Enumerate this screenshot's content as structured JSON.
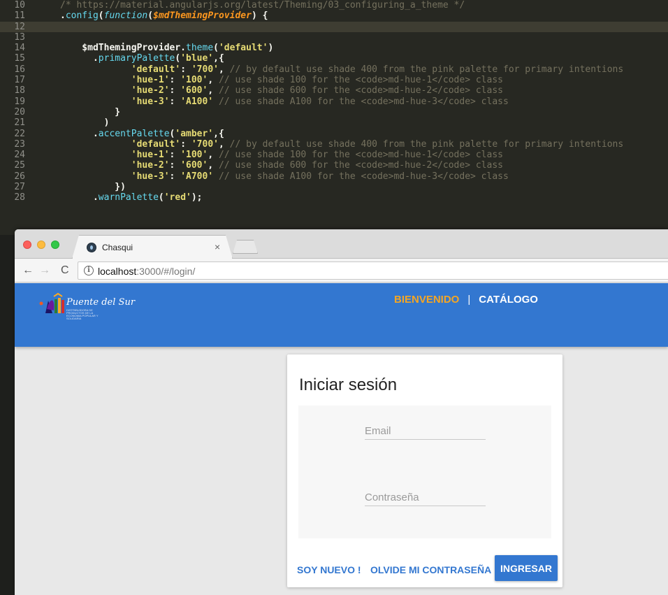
{
  "editor": {
    "active_line": 12,
    "lines": [
      {
        "n": "10",
        "tokens": [
          {
            "t": "/* https://material.angularjs.org/latest/Theming/03_configuring_a_theme */",
            "c": "comment"
          }
        ]
      },
      {
        "n": "11",
        "tokens": [
          {
            "t": ".",
            "c": "plain"
          },
          {
            "t": "config",
            "c": "func"
          },
          {
            "t": "(",
            "c": "plain"
          },
          {
            "t": "function",
            "c": "kw"
          },
          {
            "t": "(",
            "c": "plain"
          },
          {
            "t": "$mdThemingProvider",
            "c": "param"
          },
          {
            "t": ") {",
            "c": "plain"
          }
        ]
      },
      {
        "n": "12",
        "tokens": []
      },
      {
        "n": "13",
        "tokens": []
      },
      {
        "n": "14",
        "tokens": [
          {
            "t": "    $mdThemingProvider.",
            "c": "plain"
          },
          {
            "t": "theme",
            "c": "func"
          },
          {
            "t": "(",
            "c": "plain"
          },
          {
            "t": "'default'",
            "c": "string"
          },
          {
            "t": ")",
            "c": "plain"
          }
        ]
      },
      {
        "n": "15",
        "tokens": [
          {
            "t": "      .",
            "c": "plain"
          },
          {
            "t": "primaryPalette",
            "c": "func"
          },
          {
            "t": "(",
            "c": "plain"
          },
          {
            "t": "'blue'",
            "c": "string"
          },
          {
            "t": ",{",
            "c": "plain"
          }
        ]
      },
      {
        "n": "16",
        "tokens": [
          {
            "t": "             ",
            "c": "plain"
          },
          {
            "t": "'default'",
            "c": "string"
          },
          {
            "t": ": ",
            "c": "plain"
          },
          {
            "t": "'700'",
            "c": "string"
          },
          {
            "t": ", ",
            "c": "plain"
          },
          {
            "t": "// by default use shade 400 from the pink palette for primary intentions",
            "c": "comment"
          }
        ]
      },
      {
        "n": "17",
        "tokens": [
          {
            "t": "             ",
            "c": "plain"
          },
          {
            "t": "'hue-1'",
            "c": "string"
          },
          {
            "t": ": ",
            "c": "plain"
          },
          {
            "t": "'100'",
            "c": "string"
          },
          {
            "t": ", ",
            "c": "plain"
          },
          {
            "t": "// use shade 100 for the <code>md-hue-1</code> class",
            "c": "comment"
          }
        ]
      },
      {
        "n": "18",
        "tokens": [
          {
            "t": "             ",
            "c": "plain"
          },
          {
            "t": "'hue-2'",
            "c": "string"
          },
          {
            "t": ": ",
            "c": "plain"
          },
          {
            "t": "'600'",
            "c": "string"
          },
          {
            "t": ", ",
            "c": "plain"
          },
          {
            "t": "// use shade 600 for the <code>md-hue-2</code> class",
            "c": "comment"
          }
        ]
      },
      {
        "n": "19",
        "tokens": [
          {
            "t": "             ",
            "c": "plain"
          },
          {
            "t": "'hue-3'",
            "c": "string"
          },
          {
            "t": ": ",
            "c": "plain"
          },
          {
            "t": "'A100'",
            "c": "string"
          },
          {
            "t": " ",
            "c": "plain"
          },
          {
            "t": "// use shade A100 for the <code>md-hue-3</code> class",
            "c": "comment"
          }
        ]
      },
      {
        "n": "20",
        "tokens": [
          {
            "t": "          }",
            "c": "plain"
          }
        ]
      },
      {
        "n": "21",
        "tokens": [
          {
            "t": "        )",
            "c": "plain"
          }
        ]
      },
      {
        "n": "22",
        "tokens": [
          {
            "t": "      .",
            "c": "plain"
          },
          {
            "t": "accentPalette",
            "c": "func"
          },
          {
            "t": "(",
            "c": "plain"
          },
          {
            "t": "'amber'",
            "c": "string"
          },
          {
            "t": ",{",
            "c": "plain"
          }
        ]
      },
      {
        "n": "23",
        "tokens": [
          {
            "t": "             ",
            "c": "plain"
          },
          {
            "t": "'default'",
            "c": "string"
          },
          {
            "t": ": ",
            "c": "plain"
          },
          {
            "t": "'700'",
            "c": "string"
          },
          {
            "t": ", ",
            "c": "plain"
          },
          {
            "t": "// by default use shade 400 from the pink palette for primary intentions",
            "c": "comment"
          }
        ]
      },
      {
        "n": "24",
        "tokens": [
          {
            "t": "             ",
            "c": "plain"
          },
          {
            "t": "'hue-1'",
            "c": "string"
          },
          {
            "t": ": ",
            "c": "plain"
          },
          {
            "t": "'100'",
            "c": "string"
          },
          {
            "t": ", ",
            "c": "plain"
          },
          {
            "t": "// use shade 100 for the <code>md-hue-1</code> class",
            "c": "comment"
          }
        ]
      },
      {
        "n": "25",
        "tokens": [
          {
            "t": "             ",
            "c": "plain"
          },
          {
            "t": "'hue-2'",
            "c": "string"
          },
          {
            "t": ": ",
            "c": "plain"
          },
          {
            "t": "'600'",
            "c": "string"
          },
          {
            "t": ", ",
            "c": "plain"
          },
          {
            "t": "// use shade 600 for the <code>md-hue-2</code> class",
            "c": "comment"
          }
        ]
      },
      {
        "n": "26",
        "tokens": [
          {
            "t": "             ",
            "c": "plain"
          },
          {
            "t": "'hue-3'",
            "c": "string"
          },
          {
            "t": ": ",
            "c": "plain"
          },
          {
            "t": "'A700'",
            "c": "string"
          },
          {
            "t": " ",
            "c": "plain"
          },
          {
            "t": "// use shade A100 for the <code>md-hue-3</code> class",
            "c": "comment"
          }
        ]
      },
      {
        "n": "27",
        "tokens": [
          {
            "t": "          })",
            "c": "plain"
          }
        ]
      },
      {
        "n": "28",
        "tokens": [
          {
            "t": "      .",
            "c": "plain"
          },
          {
            "t": "warnPalette",
            "c": "func"
          },
          {
            "t": "(",
            "c": "plain"
          },
          {
            "t": "'red'",
            "c": "string"
          },
          {
            "t": ");",
            "c": "plain"
          }
        ]
      }
    ]
  },
  "browser": {
    "tab_title": "Chasqui",
    "tab_close": "×",
    "url_host": "localhost",
    "url_rest": ":3000/#/login/",
    "nav_back": "←",
    "nav_forward": "→",
    "nav_reload": "C",
    "info_glyph": "i"
  },
  "app": {
    "logo_text": "Puente del Sur",
    "logo_subtext": "DISTRIBUIDORA DE PRODUCTOS DE LA ECONOMIA POPULAR Y SOLIDARIA",
    "nav_welcome": "BIENVENIDO",
    "nav_separator": "|",
    "nav_catalog": "CATÁLOGO",
    "colors": {
      "primary": "#3377d0",
      "accent": "#f5a623"
    }
  },
  "login": {
    "title": "Iniciar sesión",
    "email_placeholder": "Email",
    "password_placeholder": "Contraseña",
    "new_user_label": "SOY NUEVO !",
    "forgot_label": "OLVIDE MI CONTRASEÑA",
    "submit_label": "INGRESAR"
  }
}
